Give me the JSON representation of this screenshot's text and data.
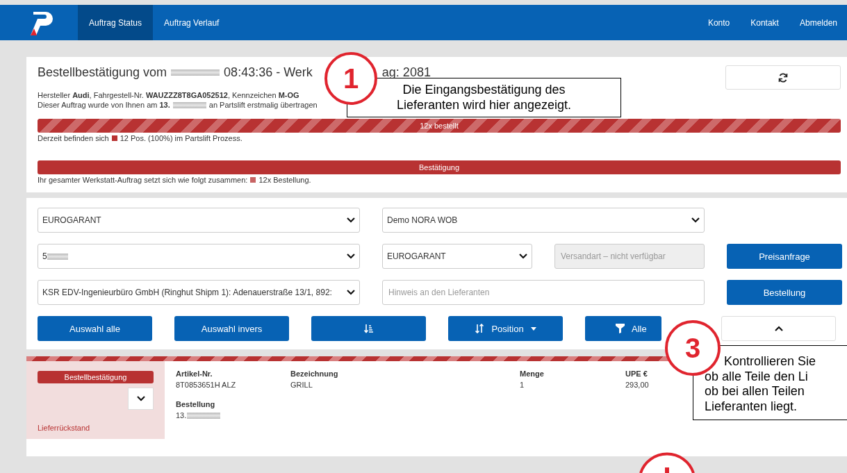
{
  "nav": {
    "tabs": [
      {
        "label": "Auftrag Status",
        "selected": true
      },
      {
        "label": "Auftrag Verlauf",
        "selected": false
      }
    ],
    "links": [
      "Konto",
      "Kontakt",
      "Abmelden"
    ]
  },
  "header": {
    "title_start": "Bestellbestätigung vom",
    "title_time": "08:43:36 - Werk",
    "title_end": "ag: 2081",
    "vehicle": "Hersteller **Audi**, Fahrgestell-Nr. **WAUZZZ8T8GA052512**, Kennzeichen **M-OG**",
    "transfer_start": "Dieser Auftrag wurde von Ihnen am **13.**",
    "transfer_end": "an Partslift erstmalig übertragen",
    "bars": [
      {
        "label": "12x bestellt",
        "kind": "striped",
        "note_start": "Derzeit befinden sich",
        "color": "#b83232",
        "note_end": "12 Pos. (100%) im Partslift Prozess."
      },
      {
        "label": "Bestätigung",
        "kind": "solid",
        "note_start": "Ihr gesamter Werkstatt-Auftrag setzt sich wie folgt zusammen:",
        "color": "#c86464",
        "note_end": "12x Bestellung."
      }
    ]
  },
  "form": {
    "supplier": "EUROGARANT",
    "branch": "Demo NORA WOB",
    "account": "5",
    "supplier2": "EUROGARANT",
    "shipping": {
      "placeholder": "Versandart – nicht verfügbar",
      "disabled": true
    },
    "address": "KSR EDV-Ingenieurbüro GmbH (Ringhut Shipm 1): Adenauerstraße 13/1, 892:",
    "note": {
      "placeholder": "Hinweis an den Lieferanten"
    },
    "actions": [
      "Preisanfrage",
      "Bestellung"
    ]
  },
  "toolbar": {
    "select_all": "Auswahl alle",
    "select_invert": "Auswahl invers",
    "sort": "Position",
    "filter": "Alle"
  },
  "item": {
    "status": "Bestellbestätigung",
    "state": "Lieferrückstand",
    "expanded": false,
    "columns": [
      {
        "label": "Artikel-Nr.",
        "value": "8T0853651H ALZ"
      },
      {
        "label": "Bezeichnung",
        "value": "GRILL"
      },
      {
        "label": "Menge",
        "value": "1"
      },
      {
        "label": "UPE €",
        "value": "293,00"
      }
    ],
    "order_label": "Bestellung",
    "order_value": "13."
  },
  "callouts": [
    {
      "number": "1",
      "lines": [
        "Die Eingangsbestätigung des",
        "Lieferanten wird hier angezeigt."
      ]
    },
    {
      "number": "3",
      "lines": [
        "Kontrollieren Sie",
        "ob alle Teile den Li",
        "ob bei allen Teilen",
        "Lieferanten liegt."
      ]
    }
  ]
}
